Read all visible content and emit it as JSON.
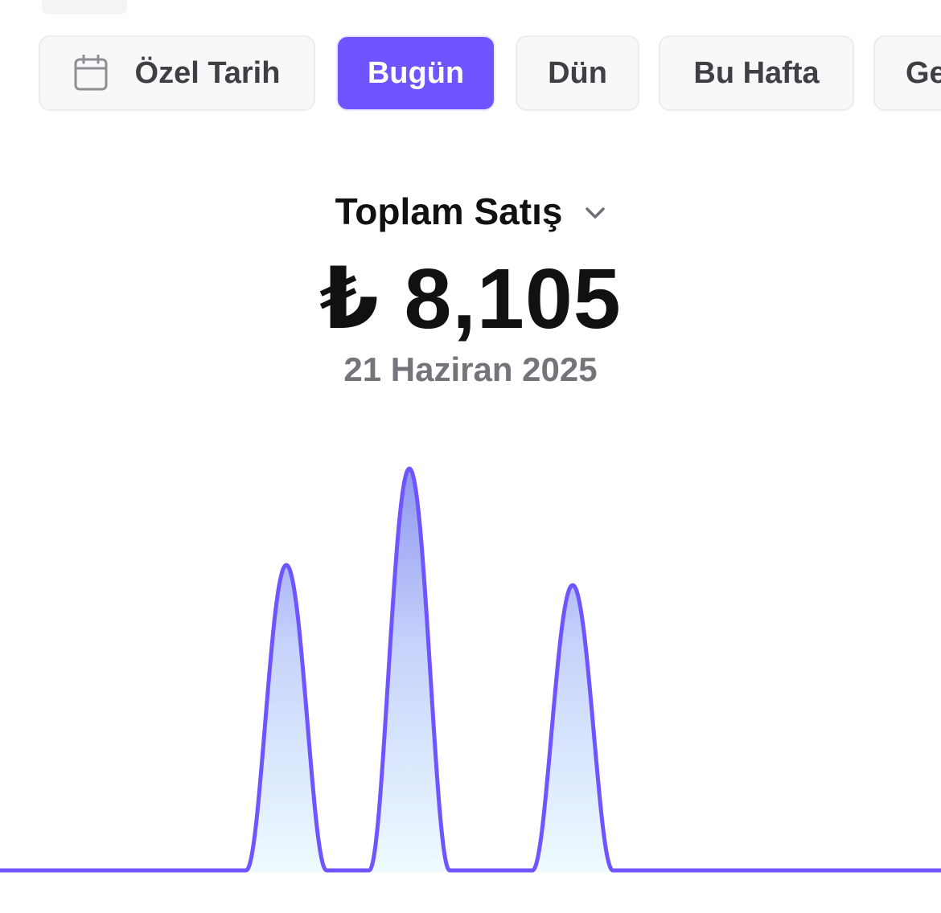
{
  "filters": {
    "items": [
      {
        "label": "Özel Tarih",
        "icon": "calendar-icon",
        "active": false
      },
      {
        "label": "Bugün",
        "active": true
      },
      {
        "label": "Dün",
        "active": false
      },
      {
        "label": "Bu Hafta",
        "active": false
      },
      {
        "label": "Ge",
        "active": false
      }
    ]
  },
  "summary": {
    "metric": "Toplam Satış",
    "metric_icon": "chevron-down-icon",
    "amount": "₺ 8,105",
    "date": "21 Haziran 2025"
  },
  "colors": {
    "accent": "#6e55ff",
    "line": "#6e55ff",
    "fill_top": "#8f97f0",
    "fill_bottom": "#eefbff"
  },
  "chart_data": {
    "type": "area",
    "title": "",
    "xlabel": "",
    "ylabel": "",
    "grid": false,
    "legend": "none",
    "series": [
      {
        "values": [
          0,
          0,
          0,
          0,
          0,
          0,
          0,
          0,
          0,
          0,
          0,
          0,
          0,
          0,
          0,
          0,
          0,
          0,
          0,
          0,
          0,
          0,
          0,
          0
        ]
      }
    ],
    "peaks": [
      {
        "value": 0.76
      },
      {
        "value": 1.0
      },
      {
        "value": 0.71
      }
    ]
  }
}
